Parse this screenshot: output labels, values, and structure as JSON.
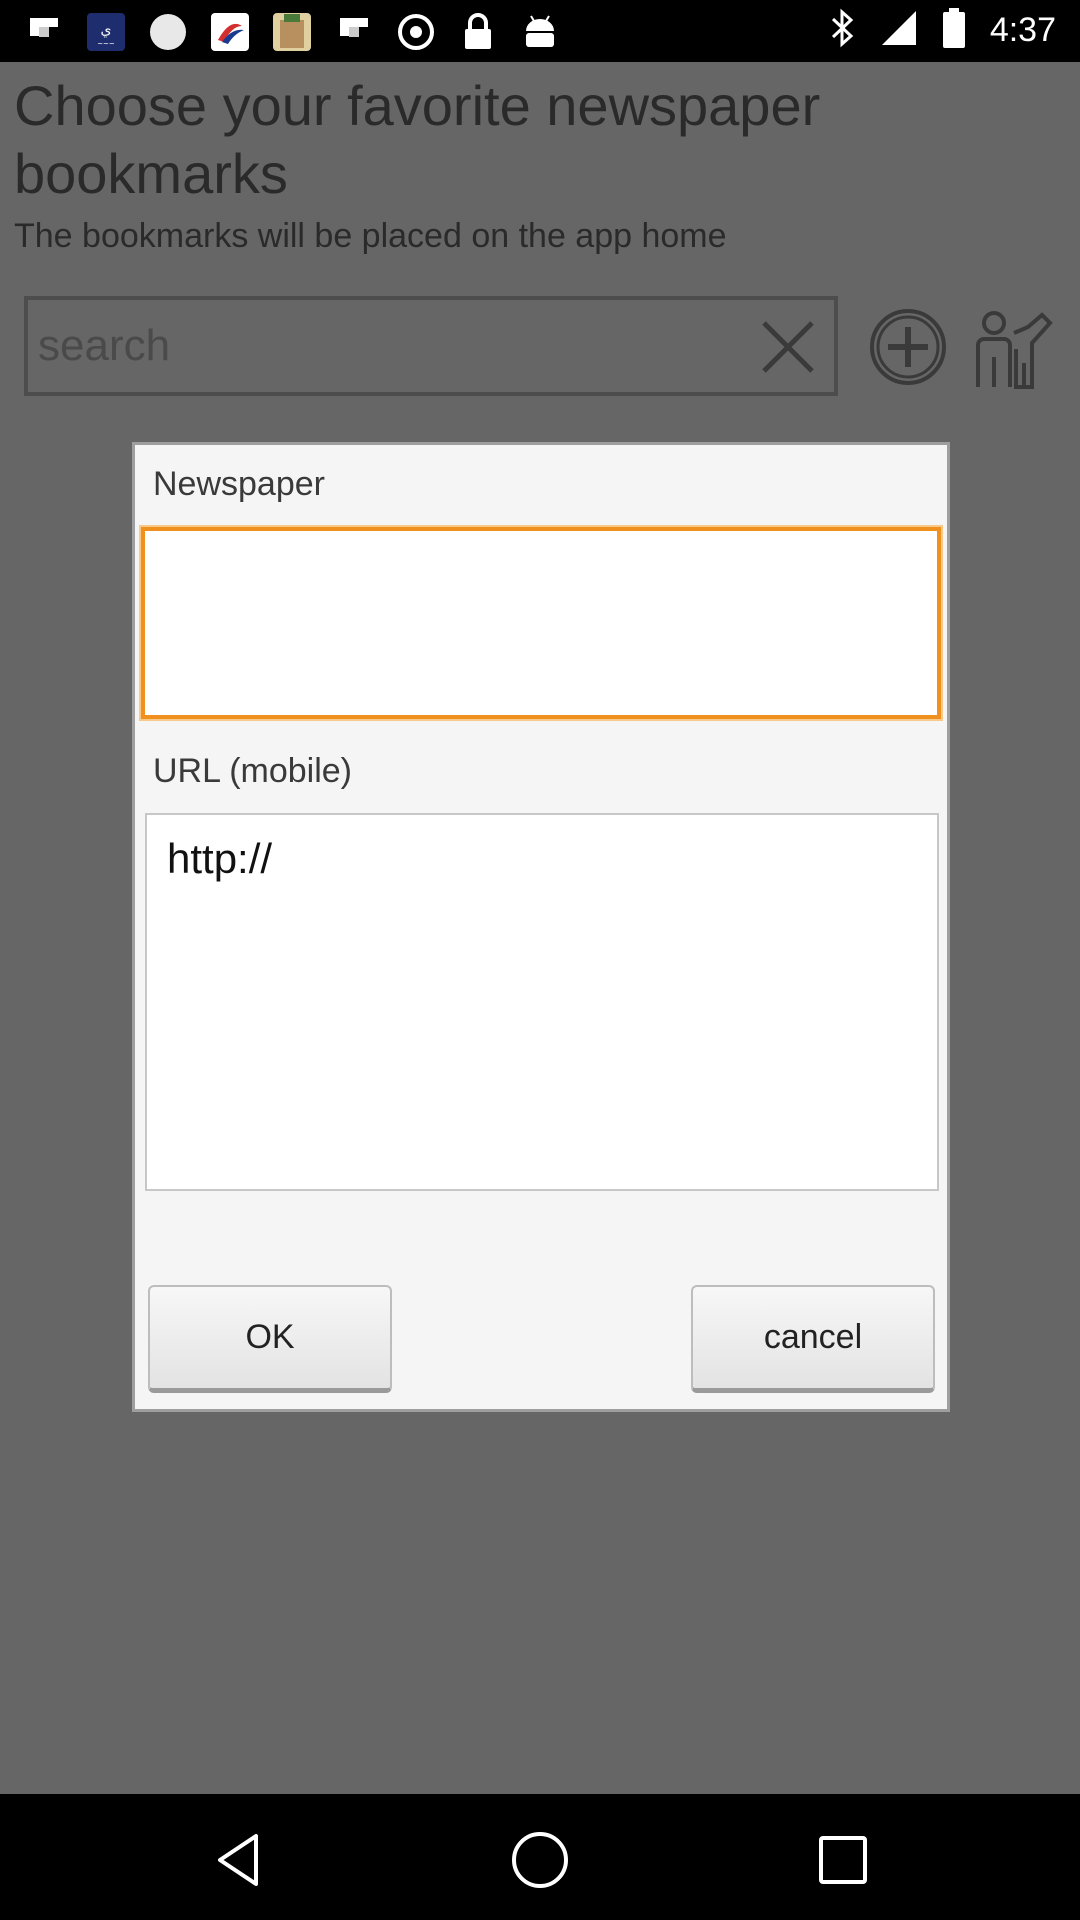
{
  "status_bar": {
    "time": "4:37",
    "notification_icons": [
      "flipboard-icon",
      "arabic-app-icon",
      "circle-icon",
      "airline-app-icon",
      "photo-app-icon",
      "flipboard-icon",
      "settings-circle-icon",
      "lock-icon",
      "android-icon"
    ],
    "right_icons": [
      "bluetooth-icon",
      "signal-icon",
      "battery-icon"
    ]
  },
  "page": {
    "title": "Choose your favorite newspaper bookmarks",
    "subtitle": "The bookmarks will be placed on the app home",
    "search_placeholder": "search"
  },
  "dialog": {
    "newspaper_label": "Newspaper",
    "newspaper_value": "",
    "url_label": "URL (mobile)",
    "url_value": "http://",
    "ok_label": "OK",
    "cancel_label": "cancel"
  },
  "colors": {
    "focus_border": "#f0901f",
    "dim_background": "#666666"
  }
}
